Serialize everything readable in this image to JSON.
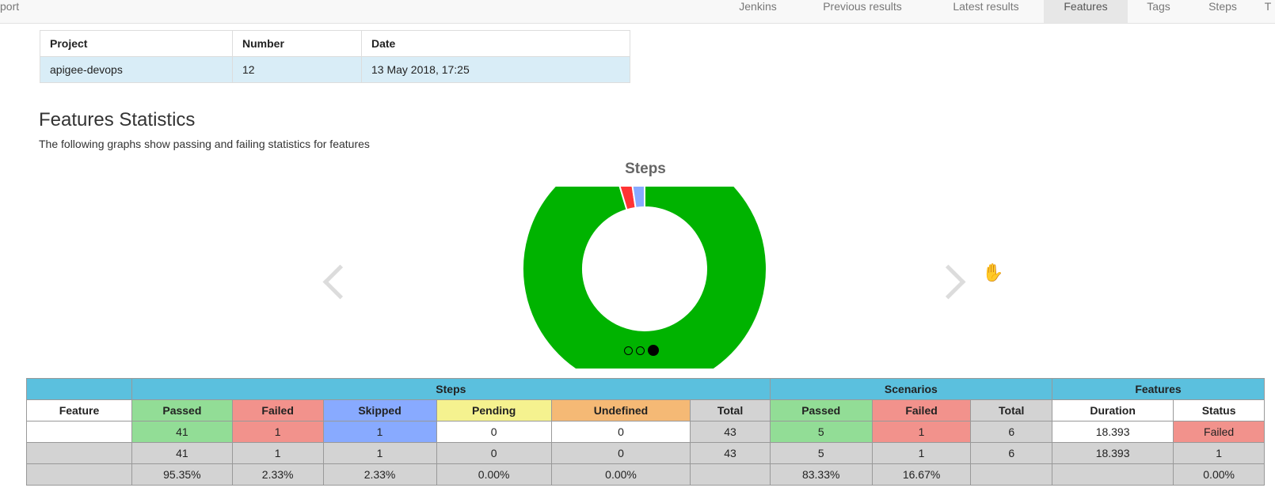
{
  "nav": {
    "brand": "port",
    "items": [
      "Jenkins",
      "Previous results",
      "Latest results",
      "Features",
      "Tags",
      "Steps",
      "T"
    ],
    "active": "Features"
  },
  "build_info": {
    "headers": [
      "Project",
      "Number",
      "Date"
    ],
    "row": [
      "apigee-devops",
      "12",
      "13 May 2018, 17:25"
    ]
  },
  "section": {
    "title": "Features Statistics",
    "subtitle": "The following graphs show passing and failing statistics for features"
  },
  "chart": {
    "title": "Steps",
    "slices": [
      {
        "label": "Passed",
        "value": 41,
        "color": "#00b300"
      },
      {
        "label": "Failed",
        "value": 1,
        "color": "#ff3333"
      },
      {
        "label": "Skipped",
        "value": 1,
        "color": "#88aaff"
      }
    ],
    "carousel_index": 3,
    "carousel_count": 3
  },
  "stats": {
    "group_headers": [
      "Steps",
      "Scenarios",
      "Features"
    ],
    "column_headers": [
      "Feature",
      "Passed",
      "Failed",
      "Skipped",
      "Pending",
      "Undefined",
      "Total",
      "Passed",
      "Failed",
      "Total",
      "Duration",
      "Status"
    ],
    "feature_row": [
      "",
      "41",
      "1",
      "1",
      "0",
      "0",
      "43",
      "5",
      "1",
      "6",
      "18.393",
      "Failed"
    ],
    "totals_row": [
      "",
      "41",
      "1",
      "1",
      "0",
      "0",
      "43",
      "5",
      "1",
      "6",
      "18.393",
      "1"
    ],
    "percent_row": [
      "",
      "95.35%",
      "2.33%",
      "2.33%",
      "0.00%",
      "0.00%",
      "",
      "83.33%",
      "16.67%",
      "",
      "",
      "0.00%"
    ]
  },
  "colors": {
    "passed": "#92dd96",
    "failed": "#f2928c",
    "skipped": "#88aaff",
    "pending": "#f5f28f",
    "undefined": "#f5b975",
    "header": "#5bc0de"
  }
}
